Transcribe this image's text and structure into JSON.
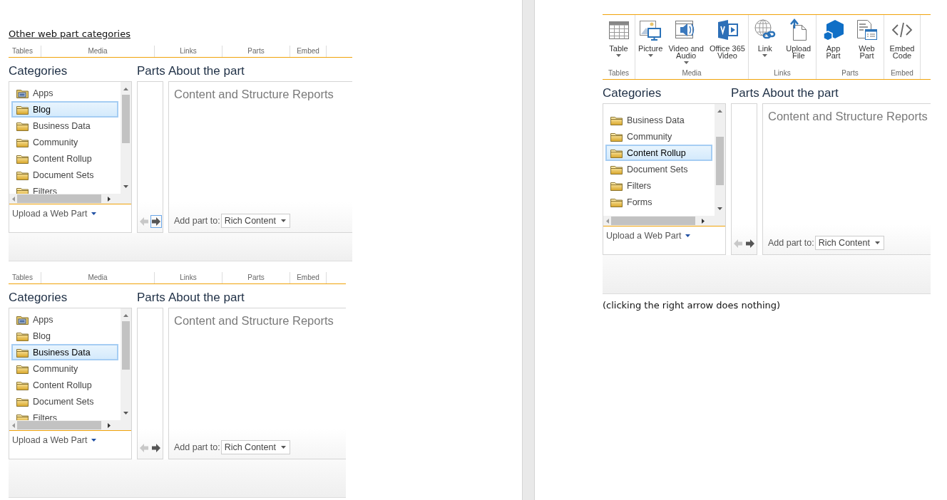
{
  "heading": {
    "text": "Other web part categories"
  },
  "panels": [
    {
      "ribbon": {
        "groups": [
          {
            "label": "Tables"
          },
          {
            "label": "Media"
          },
          {
            "label": "Links"
          },
          {
            "label": "Parts"
          },
          {
            "label": "Embed"
          }
        ]
      },
      "categories": {
        "title": "Categories",
        "scrolled": false,
        "items": [
          {
            "label": "Apps",
            "kind": "app-folder",
            "selected": false
          },
          {
            "label": "Blog",
            "kind": "folder",
            "selected": true
          },
          {
            "label": "Business Data",
            "kind": "folder",
            "selected": false
          },
          {
            "label": "Community",
            "kind": "folder",
            "selected": false
          },
          {
            "label": "Content Rollup",
            "kind": "folder",
            "selected": false
          },
          {
            "label": "Document Sets",
            "kind": "folder",
            "selected": false
          },
          {
            "label": "Filters",
            "kind": "folder",
            "selected": false
          }
        ],
        "upload": "Upload a Web Part"
      },
      "parts": {
        "title": "Parts",
        "nav": [
          {
            "kind": "previous",
            "disabled": true,
            "focused": false
          },
          {
            "kind": "next",
            "disabled": false,
            "focused": true
          }
        ]
      },
      "about": {
        "title": "About the part",
        "name": "Content and Structure Reports",
        "add_label": "Add part to:",
        "target": "Rich Content"
      }
    },
    {
      "ribbon": {
        "groups": [
          {
            "label": "Tables"
          },
          {
            "label": "Media"
          },
          {
            "label": "Links"
          },
          {
            "label": "Parts"
          },
          {
            "label": "Embed"
          }
        ]
      },
      "categories": {
        "title": "Categories",
        "scrolled": false,
        "items": [
          {
            "label": "Apps",
            "kind": "app-folder",
            "selected": false
          },
          {
            "label": "Blog",
            "kind": "folder",
            "selected": false
          },
          {
            "label": "Business Data",
            "kind": "folder",
            "selected": true
          },
          {
            "label": "Community",
            "kind": "folder",
            "selected": false
          },
          {
            "label": "Content Rollup",
            "kind": "folder",
            "selected": false
          },
          {
            "label": "Document Sets",
            "kind": "folder",
            "selected": false
          },
          {
            "label": "Filters",
            "kind": "folder",
            "selected": false
          }
        ],
        "upload": "Upload a Web Part"
      },
      "parts": {
        "title": "Parts",
        "nav": [
          {
            "kind": "previous",
            "disabled": true,
            "focused": false
          },
          {
            "kind": "next",
            "disabled": false,
            "focused": false
          }
        ]
      },
      "about": {
        "title": "About the part",
        "name": "Content and Structure Reports",
        "add_label": "Add part to:",
        "target": "Rich Content"
      }
    },
    {
      "ribbon": {
        "groups": [
          {
            "label": "Tables",
            "buttons": [
              {
                "label": "Table",
                "kind": "table",
                "dropdown": true
              }
            ]
          },
          {
            "label": "Media",
            "buttons": [
              {
                "label": "Picture",
                "kind": "picture",
                "dropdown": true
              },
              {
                "label": "Video and\nAudio",
                "kind": "video",
                "dropdown": true
              },
              {
                "label": "Office 365\nVideo",
                "kind": "office-video",
                "dropdown": false
              }
            ]
          },
          {
            "label": "Links",
            "buttons": [
              {
                "label": "Link",
                "kind": "link",
                "dropdown": true
              },
              {
                "label": "Upload\nFile",
                "kind": "upload",
                "dropdown": false
              }
            ]
          },
          {
            "label": "Parts",
            "buttons": [
              {
                "label": "App\nPart",
                "kind": "app-part",
                "dropdown": false
              },
              {
                "label": "Web\nPart",
                "kind": "web-part",
                "dropdown": false
              }
            ]
          },
          {
            "label": "Embed",
            "buttons": [
              {
                "label": "Embed\nCode",
                "kind": "embed",
                "dropdown": false
              }
            ]
          }
        ]
      },
      "categories": {
        "title": "Categories",
        "scrolled": true,
        "items": [
          {
            "label": "Business Data",
            "kind": "folder",
            "selected": false
          },
          {
            "label": "Community",
            "kind": "folder",
            "selected": false
          },
          {
            "label": "Content Rollup",
            "kind": "folder",
            "selected": true
          },
          {
            "label": "Document Sets",
            "kind": "folder",
            "selected": false
          },
          {
            "label": "Filters",
            "kind": "folder",
            "selected": false
          },
          {
            "label": "Forms",
            "kind": "folder",
            "selected": false
          }
        ],
        "upload": "Upload a Web Part"
      },
      "parts": {
        "title": "Parts",
        "nav": [
          {
            "kind": "previous",
            "disabled": true,
            "focused": false
          },
          {
            "kind": "next",
            "disabled": false,
            "focused": false
          }
        ]
      },
      "about": {
        "title": "About the part",
        "name": "Content and Structure Reports",
        "add_label": "Add part to:",
        "target": "Rich Content"
      }
    }
  ],
  "caption": {
    "text": "(clicking the right arrow does nothing)"
  }
}
